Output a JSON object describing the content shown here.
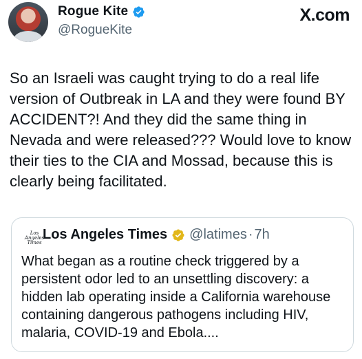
{
  "tweet": {
    "author_name": "Rogue Kite",
    "author_handle": "@RogueKite",
    "platform": "X.com",
    "text": "So an Israeli was caught trying to do a real life version of Outbreak in LA and they were found BY ACCIDENT?! And they did the same thing in Nevada and were released??? Would love to know their ties to the CIA and Mossad, because this is clearly being facilitated."
  },
  "quoted_tweet": {
    "logo_text": "Los Angeles Times",
    "author_name": "Los Angeles Times",
    "author_handle": "@latimes",
    "separator": "·",
    "time": "7h",
    "text": "What began as a routine check triggered by a persistent odor led to an unsettling discovery: a hidden lab operating inside a California warehouse containing dangerous pathogens including HIV, malaria, COVID-19 and Ebola...."
  },
  "colors": {
    "verified_blue": "#1d9bf0",
    "verified_gold": "#e2b719",
    "secondary_text": "#536471",
    "border": "#cfd9de"
  },
  "icons": {
    "author_badge": "verified-blue-check-icon",
    "quoted_badge": "verified-gold-check-icon"
  }
}
